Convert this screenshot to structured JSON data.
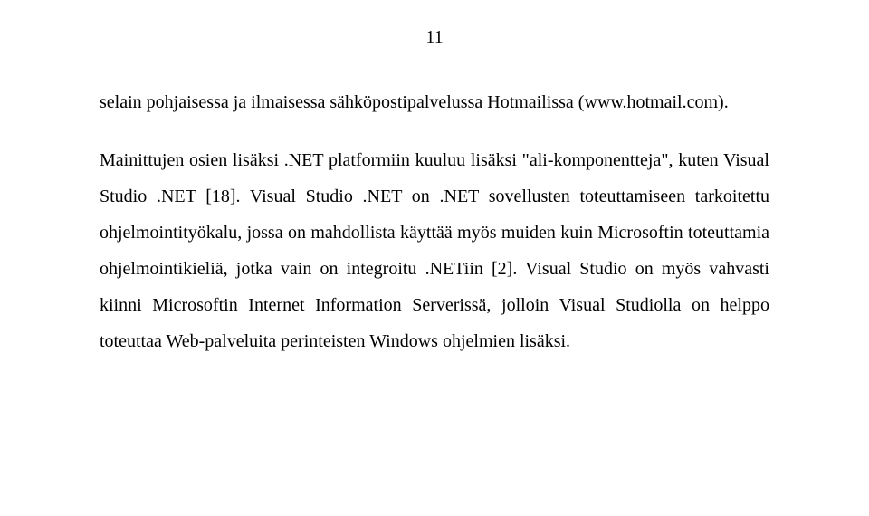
{
  "pageNumber": "11",
  "paragraphs": [
    "selain pohjaisessa ja ilmaisessa sähköpostipalvelussa Hotmailissa (www.hotmail.com).",
    "Mainittujen osien lisäksi .NET platformiin kuuluu lisäksi \"ali-komponentteja\", kuten Visual Studio .NET [18]. Visual Studio .NET on .NET sovellusten toteuttamiseen tarkoitettu ohjelmointityökalu, jossa on mahdollista käyttää myös muiden kuin Microsoftin toteuttamia ohjelmointikieliä, jotka vain on integroitu .NETiin [2]. Visual Studio on myös vahvasti kiinni Microsoftin Internet Information Serverissä, jolloin Visual Studiolla on helppo toteuttaa Web-palveluita perinteisten Windows ohjelmien lisäksi."
  ]
}
